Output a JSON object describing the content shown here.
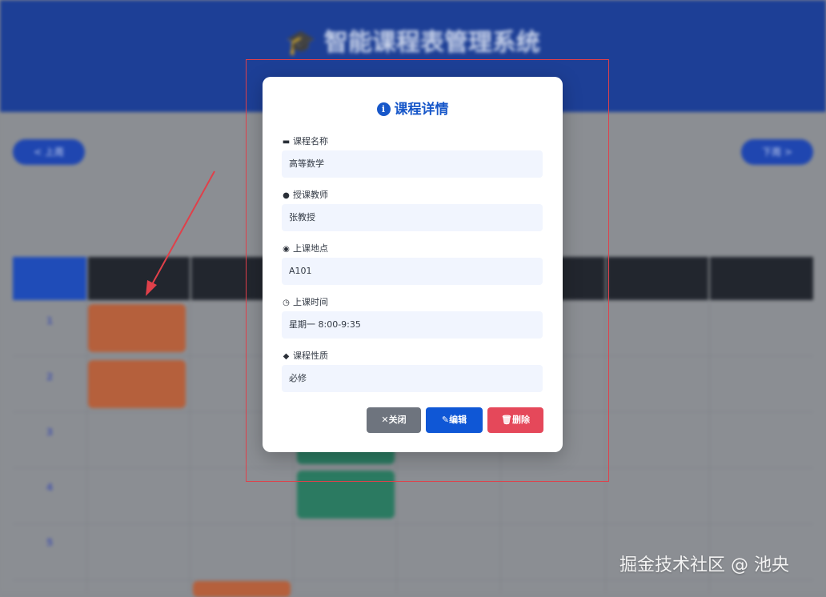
{
  "header": {
    "title": "智能课程表管理系统",
    "subtitle": ""
  },
  "nav": {
    "prev_label": "< 上周",
    "next_label": "下周 >"
  },
  "schedule": {
    "corner_label": "",
    "days": [
      "",
      "",
      "",
      "",
      "",
      "",
      ""
    ],
    "periods": [
      {
        "num": "1",
        "time": ""
      },
      {
        "num": "2",
        "time": ""
      },
      {
        "num": "3",
        "time": ""
      },
      {
        "num": "4",
        "time": ""
      },
      {
        "num": "5",
        "time": ""
      }
    ]
  },
  "modal": {
    "title": "课程详情",
    "fields": [
      {
        "label": "课程名称",
        "value": "高等数学",
        "icon": "book-icon"
      },
      {
        "label": "授课教师",
        "value": "张教授",
        "icon": "user-icon"
      },
      {
        "label": "上课地点",
        "value": "A101",
        "icon": "map-pin-icon"
      },
      {
        "label": "上课时间",
        "value": "星期一 8:00-9:35",
        "icon": "clock-icon"
      },
      {
        "label": "课程性质",
        "value": "必修",
        "icon": "tags-icon"
      }
    ],
    "buttons": {
      "close": "关闭",
      "edit": "编辑",
      "delete": "删除"
    }
  },
  "watermark": "掘金技术社区 @ 池央",
  "colors": {
    "header_bg": "#1d3f96",
    "modal_title": "#1757c9",
    "field_bg": "#f1f5fe",
    "close_btn": "#6e747e",
    "edit_btn": "#0f57d6",
    "delete_btn": "#e5485a",
    "highlight": "#e0404a"
  }
}
